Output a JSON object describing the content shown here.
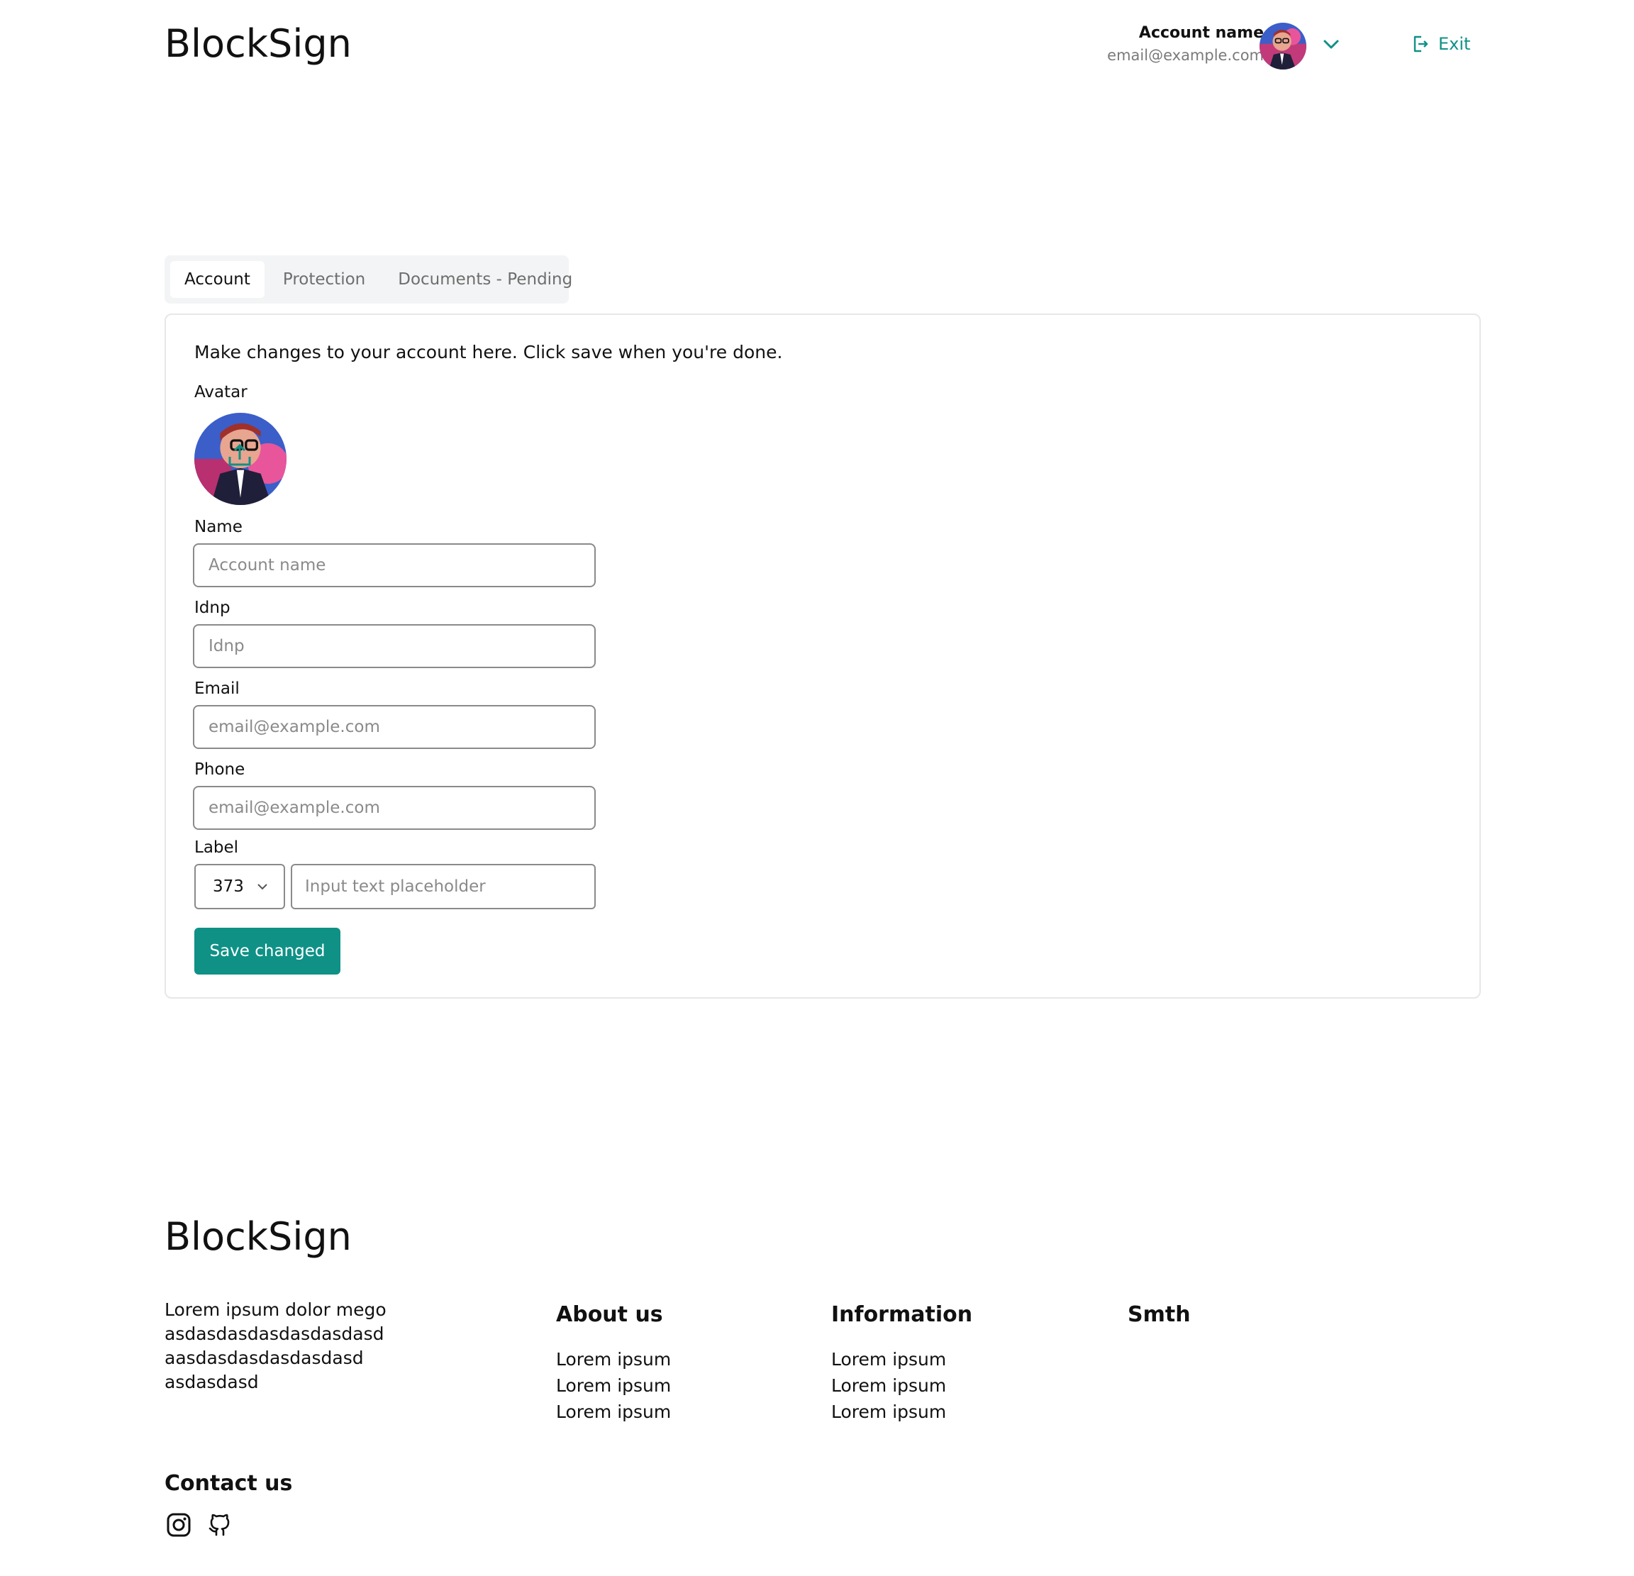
{
  "header": {
    "brand": "BlockSign",
    "account_name": "Account name",
    "account_email": "email@example.com",
    "exit_label": "Exit"
  },
  "tabs": [
    {
      "label": "Account",
      "active": true
    },
    {
      "label": "Protection",
      "active": false
    },
    {
      "label": "Documents - Pending",
      "active": false
    }
  ],
  "form": {
    "intro": "Make changes to your account here. Click save when you're done.",
    "avatar_label": "Avatar",
    "name_label": "Name",
    "name_placeholder": "Account name",
    "idnp_label": "Idnp",
    "idnp_placeholder": "Idnp",
    "email_label": "Email",
    "email_placeholder": "email@example.com",
    "phone_label": "Phone",
    "phone_placeholder": "email@example.com",
    "label_label": "Label",
    "prefix_value": "373",
    "label_placeholder": "Input text placeholder",
    "save_label": "Save changed"
  },
  "footer": {
    "brand": "BlockSign",
    "text_lines": [
      "Lorem ipsum dolor mego",
      "asdasdasdasdasdasdasd",
      "aasdasdasdasdasdasd",
      "asdasdasd"
    ],
    "columns": [
      {
        "title": "About us",
        "links": [
          "Lorem ipsum",
          "Lorem ipsum",
          "Lorem ipsum"
        ]
      },
      {
        "title": "Information",
        "links": [
          "Lorem ipsum",
          "Lorem ipsum",
          "Lorem ipsum"
        ]
      },
      {
        "title": "Smth",
        "links": []
      }
    ],
    "contact_title": "Contact us",
    "social_icons": [
      "instagram-icon",
      "github-icon"
    ]
  },
  "colors": {
    "accent": "#0f9186",
    "text": "#111111",
    "muted": "#7a7a7a",
    "border": "#8a8a8a"
  }
}
